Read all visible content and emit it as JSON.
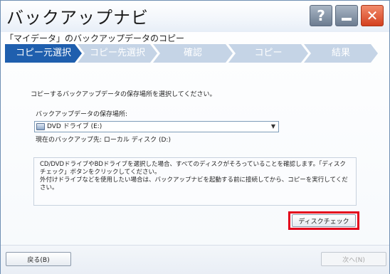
{
  "window": {
    "title": "バックアップナビ"
  },
  "title_buttons": {
    "help": "?",
    "minimize_icon": "minimize-icon",
    "close": "✕"
  },
  "subtitle": "「マイデータ」のバックアップデータのコピー",
  "steps": [
    {
      "label": "コピー元選択",
      "active": true
    },
    {
      "label": "コピー先選択",
      "active": false
    },
    {
      "label": "確認",
      "active": false
    },
    {
      "label": "コピー",
      "active": false
    },
    {
      "label": "結果",
      "active": false
    }
  ],
  "main": {
    "instruction": "コピーするバックアップデータの保存場所を選択してください。",
    "location_label": "バックアップデータの保存場所:",
    "location_selected": "DVD ドライブ (E:)",
    "current_destination": "現在のバックアップ先: ローカル ディスク (D:)",
    "notice_lines": [
      "CD/DVDドライブやBDドライブを選択した場合、すべてのディスクがそろっていることを確認します。「ディスクチェック」ボタンをクリックしてください。",
      "外付けドライブなどを使用したい場合は、バックアップナビを起動する前に接続してから、コピーを実行してください。"
    ],
    "disk_check_button": "ディスクチェック"
  },
  "footer": {
    "back": "戻る(B)",
    "next": "次へ(N)"
  },
  "colors": {
    "active_step": "#1f5fae",
    "inactive_step": "#c5d4e6",
    "highlight_border": "#e3001b",
    "close_button": "#d3401f"
  }
}
